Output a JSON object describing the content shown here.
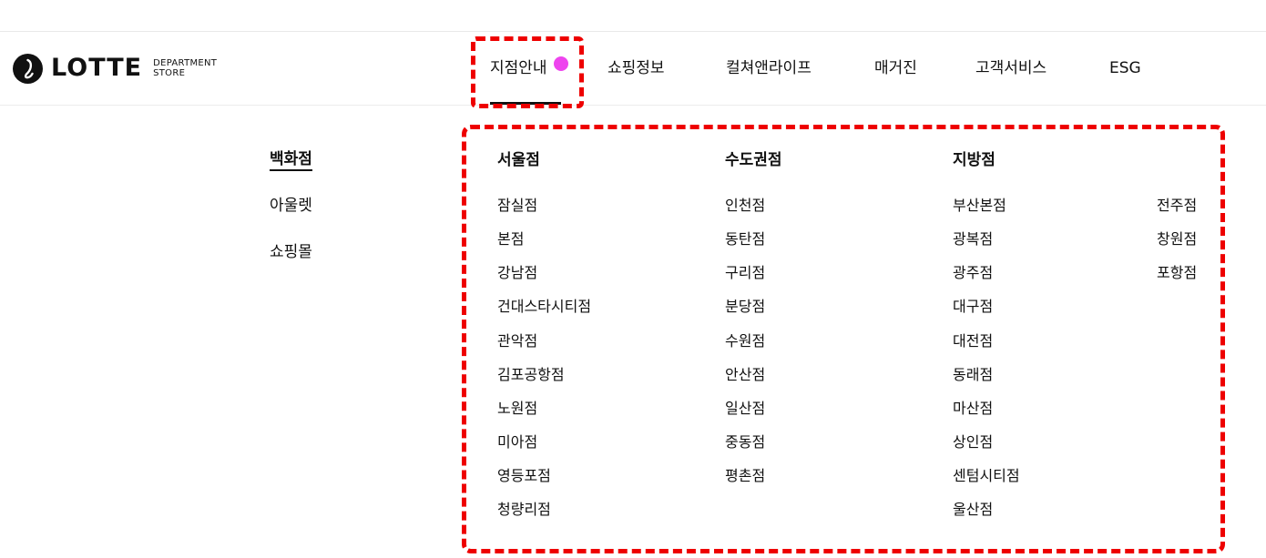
{
  "logo": {
    "word": "LOTTE",
    "sub_line1": "DEPARTMENT",
    "sub_line2": "STORE"
  },
  "gnb": [
    {
      "label": "지점안내",
      "active": true
    },
    {
      "label": "쇼핑정보"
    },
    {
      "label": "컬쳐앤라이프"
    },
    {
      "label": "매거진"
    },
    {
      "label": "고객서비스"
    },
    {
      "label": "ESG"
    }
  ],
  "categories": [
    {
      "label": "백화점",
      "selected": true
    },
    {
      "label": "아울렛"
    },
    {
      "label": "쇼핑몰"
    }
  ],
  "regions": {
    "seoul": {
      "title": "서울점",
      "stores": [
        "잠실점",
        "본점",
        "강남점",
        "건대스타시티점",
        "관악점",
        "김포공항점",
        "노원점",
        "미아점",
        "영등포점",
        "청량리점"
      ]
    },
    "capital": {
      "title": "수도권점",
      "stores": [
        "인천점",
        "동탄점",
        "구리점",
        "분당점",
        "수원점",
        "안산점",
        "일산점",
        "중동점",
        "평촌점"
      ]
    },
    "local": {
      "title": "지방점",
      "stores": [
        "부산본점",
        "광복점",
        "광주점",
        "대구점",
        "대전점",
        "동래점",
        "마산점",
        "상인점",
        "센텀시티점",
        "울산점"
      ],
      "stores_right": [
        "전주점",
        "창원점",
        "포항점"
      ]
    }
  },
  "colors": {
    "text": "#111111",
    "highlight": "#ee0000",
    "notice_dot": "#ee44ee",
    "divider": "#ececec"
  }
}
